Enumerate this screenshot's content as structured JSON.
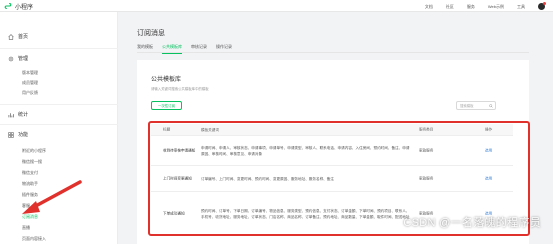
{
  "app": {
    "logo_text": "小程序"
  },
  "topnav": {
    "items": [
      "文档",
      "社区",
      "服务",
      "Web示例",
      "工具"
    ]
  },
  "sidebar": {
    "groups": [
      {
        "label": "首页",
        "icon": "home-icon"
      },
      {
        "label": "管理",
        "icon": "gear-icon"
      },
      {
        "label": "统计",
        "icon": "chart-icon"
      },
      {
        "label": "功能",
        "icon": "grid-icon"
      }
    ],
    "management_items": [
      "版本管理",
      "成员管理",
      "用户反馈"
    ],
    "function_items": [
      "附近的小程序",
      "微信搜一搜",
      "微信支付",
      "物流助手",
      "插件服务",
      "客服",
      "订阅消息",
      "直播",
      "页面内容接入"
    ]
  },
  "main": {
    "title": "订阅消息",
    "tabs": [
      "我的模板",
      "公共模板库",
      "审核记录",
      "操作记录"
    ],
    "active_tab": 1
  },
  "panel": {
    "title": "公共模板库",
    "description": "请输入关键词搜索公共模板库中的模板",
    "all_button": "一次性订阅",
    "search_placeholder": "搜索模板"
  },
  "table": {
    "headers": [
      "标题",
      "模板关键词",
      "服务类目",
      "操作"
    ],
    "rows": [
      {
        "title": "收到待审核申请通知",
        "keywords": "申请时间、申请人、审核状态、申请事项、申请单号、申请类型、审核人、联系电话、申请内容、入住房间、预约时间、备注、申请原因、审核时间、审核意见、申请对象",
        "category": "家政服务",
        "action": "选用"
      },
      {
        "title": "上门时间变更通知",
        "keywords": "订单编号、上门时间、变更时间、预约时间、变更原因、服务地址、服务名称、备注",
        "category": "家政服务",
        "action": "选用"
      },
      {
        "title": "下单成功通知",
        "keywords": "预约时间、订单号、下单日期、订单编号、物品信息、服务类型、预约信息、支付状态、订单金额、下单时间、预约项目、联系人、手机号、收货地址、服务地址、订单状态、门店名称、商品名称、订单备注、预约地址、商品数量、下单金额、取件时间、配送地址",
        "category": "家政服务",
        "action": "选用"
      }
    ]
  },
  "watermark": "CSDN @一名落魄的程序员",
  "colors": {
    "accent": "#07c160",
    "highlight": "#e0312c",
    "link": "#2e7dd7"
  }
}
